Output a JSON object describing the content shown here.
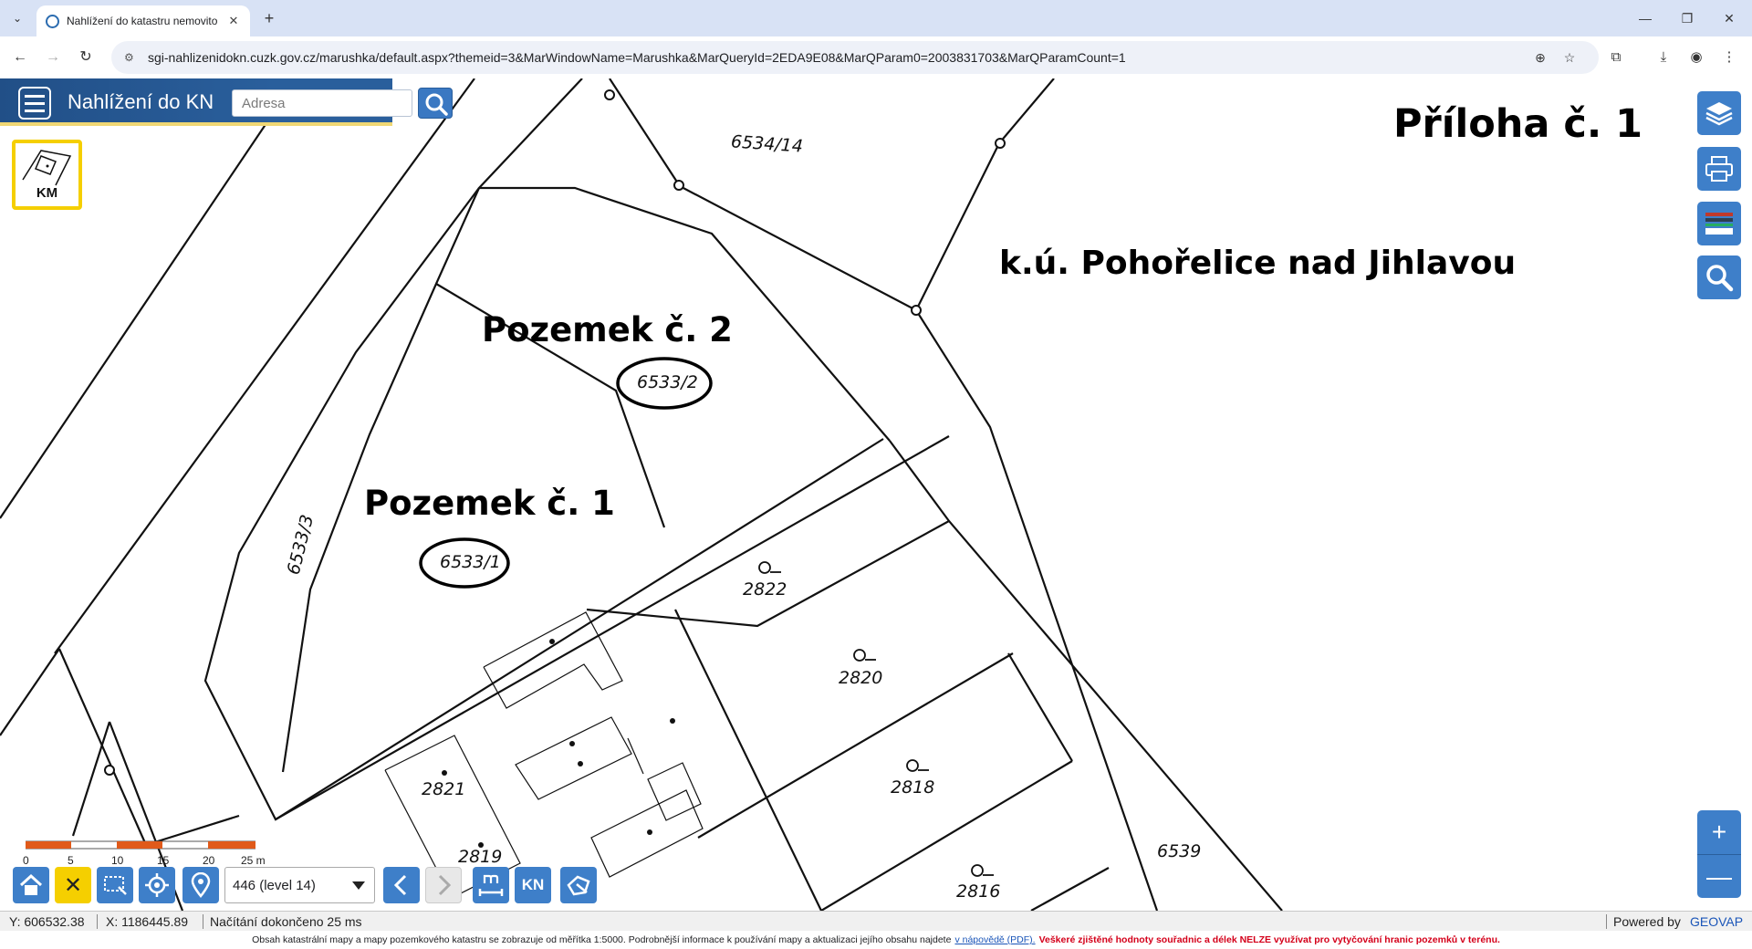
{
  "browser": {
    "tab_title": "Nahlížení do katastru nemovito",
    "url": "sgi-nahlizenidokn.cuzk.gov.cz/marushka/default.aspx?themeid=3&MarWindowName=Marushka&MarQueryId=2EDA9E08&MarQParam0=2003831703&MarQParamCount=1"
  },
  "app": {
    "title": "Nahlížení do KN",
    "search_placeholder": "Adresa",
    "km_label": "KM"
  },
  "map": {
    "parcel_labels": [
      "6534/14",
      "6533/2",
      "6533/1",
      "6533/3",
      "2822",
      "2820",
      "2821",
      "2818",
      "2819",
      "2816",
      "6539"
    ],
    "annotations": {
      "attachment": "Příloha č. 1",
      "cadastral_area": "k.ú. Pohořelice nad Jihlavou",
      "parcel_2": "Pozemek č. 2",
      "parcel_1": "Pozemek č. 1"
    }
  },
  "scale": {
    "ticks": [
      "0",
      "5",
      "10",
      "15",
      "20",
      "25 m"
    ]
  },
  "bottom_toolbar": {
    "level": "446 (level 14)",
    "kn_label": "KN"
  },
  "status": {
    "y": "Y: 606532.38",
    "x": "X: 1186445.89",
    "loading": "Načítání dokončeno 25 ms",
    "powered_by": "Powered by",
    "powered_brand": "GEOVAP"
  },
  "footnote": {
    "text": "Obsah katastrální mapy a mapy pozemkového katastru se zobrazuje od měřítka 1:5000. Podrobnější informace k používání mapy a aktualizaci jejího obsahu najdete",
    "link": "v nápovědě (PDF).",
    "warning": "Veškeré zjištěné hodnoty souřadnic a délek NELZE využívat pro vytyčování hranic pozemků v terénu."
  },
  "colors": {
    "header_blue": "#2a5f9c",
    "tool_blue": "#3e7fc9",
    "accent_yellow": "#f5cf00",
    "scale_orange": "#e05a1a",
    "warning_red": "#d4001a"
  }
}
